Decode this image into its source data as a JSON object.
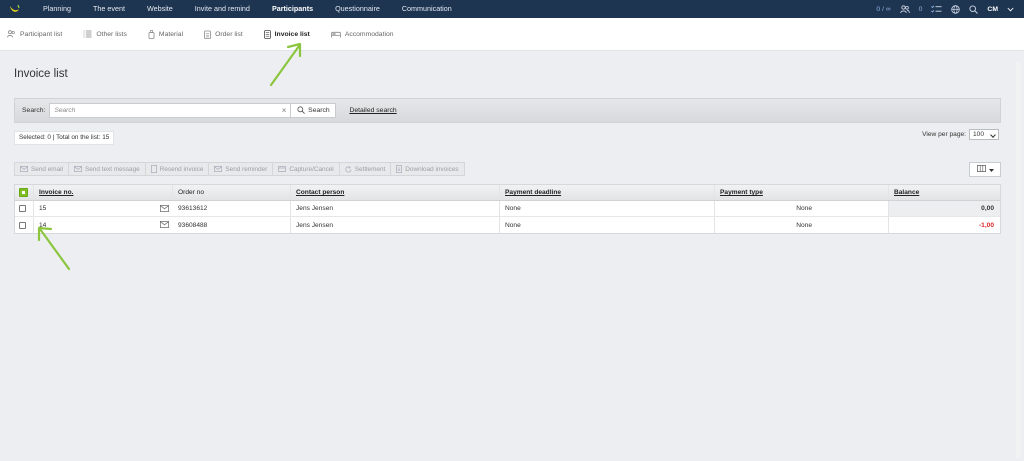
{
  "topnav": {
    "items": [
      "Planning",
      "The event",
      "Website",
      "Invite and remind",
      "Participants",
      "Questionnaire",
      "Communication"
    ],
    "active_index": 4,
    "counter_a": "0 / ∞",
    "counter_b": "0",
    "user": "CM"
  },
  "subnav": {
    "items": [
      "Participant list",
      "Other lists",
      "Material",
      "Order list",
      "Invoice list",
      "Accommodation"
    ],
    "active_index": 4
  },
  "page": {
    "title": "Invoice list"
  },
  "search": {
    "label": "Search:",
    "placeholder": "Search",
    "clear": "×",
    "button": "Search",
    "detailed": "Detailed search"
  },
  "selection": {
    "text": "Selected: 0 | Total on the list: 15"
  },
  "view_per_page": {
    "label": "View per page:",
    "value": "100"
  },
  "toolbar": [
    "Send email",
    "Send text message",
    "Resend invoice",
    "Send reminder",
    "Capture/Cancel",
    "Settlement",
    "Download invoices"
  ],
  "table": {
    "headers": [
      "Invoice no.",
      "Order no",
      "Contact person",
      "Payment deadline",
      "Payment type",
      "Balance"
    ],
    "rows": [
      {
        "invoice": "15",
        "order": "93613612",
        "contact": "Jens Jensen",
        "deadline": "None",
        "ptype": "None",
        "balance": "0,00"
      },
      {
        "invoice": "14",
        "order": "93608488",
        "contact": "Jens Jensen",
        "deadline": "None",
        "ptype": "None",
        "balance": "-1,00"
      }
    ]
  },
  "colors": {
    "nav_bg": "#1e3552",
    "accent_green": "#7fbf1f",
    "negative": "#d9252a"
  }
}
